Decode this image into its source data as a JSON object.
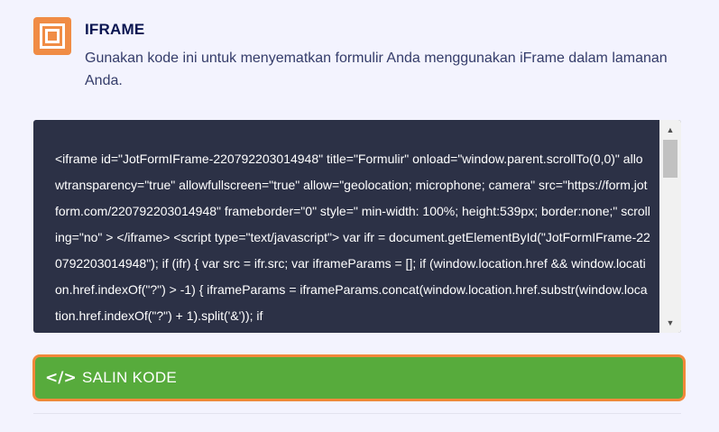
{
  "section": {
    "icon": "iframe-icon",
    "title": "IFRAME",
    "description": "Gunakan kode ini untuk menyematkan formulir Anda menggunakan iFrame dalam lamanan Anda."
  },
  "code": {
    "text": "<iframe id=\"JotFormIFrame-220792203014948\" title=\"Formulir\" onload=\"window.parent.scrollTo(0,0)\" allowtransparency=\"true\" allowfullscreen=\"true\" allow=\"geolocation; microphone; camera\" src=\"https://form.jotform.com/220792203014948\" frameborder=\"0\" style=\" min-width: 100%; height:539px; border:none;\" scrolling=\"no\" > </iframe> <script type=\"text/javascript\"> var ifr = document.getElementById(\"JotFormIFrame-220792203014948\"); if (ifr) { var src = ifr.src; var iframeParams = []; if (window.location.href && window.location.href.indexOf(\"?\") > -1) { iframeParams = iframeParams.concat(window.location.href.substr(window.location.href.indexOf(\"?\") + 1).split('&')); if"
  },
  "copy_button": {
    "icon": "code-icon",
    "label": "SALIN KODE"
  },
  "colors": {
    "accent_orange": "#f08c45",
    "code_background": "#2c3146",
    "button_green": "#57ab3c",
    "title_navy": "#0a1551"
  }
}
